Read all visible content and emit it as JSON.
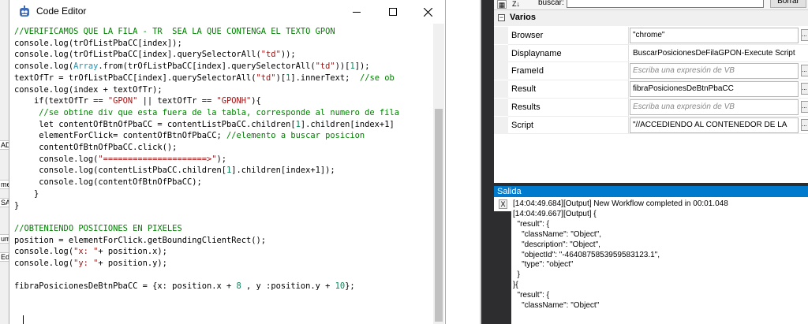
{
  "background_fragments": [
    "ADO",
    "me",
    "SAC",
    "umir",
    "Edit"
  ],
  "editor": {
    "title": "Code Editor",
    "code_lines": [
      [
        {
          "t": "//VERIFICAMOS QUE LA FILA - TR  SEA LA QUE CONTENGA EL TEXTO GPON",
          "k": "comment"
        }
      ],
      [
        {
          "t": "console.log(trOfListPbaCC[index]);",
          "k": "plain"
        }
      ],
      [
        {
          "t": "console.log(trOfListPbaCC[index].querySelectorAll(",
          "k": "plain"
        },
        {
          "t": "\"td\"",
          "k": "string"
        },
        {
          "t": "));",
          "k": "plain"
        }
      ],
      [
        {
          "t": "console.log(",
          "k": "plain"
        },
        {
          "t": "Array",
          "k": "type"
        },
        {
          "t": ".from(trOfListPbaCC[index].querySelectorAll(",
          "k": "plain"
        },
        {
          "t": "\"td\"",
          "k": "string"
        },
        {
          "t": "))[",
          "k": "plain"
        },
        {
          "t": "1",
          "k": "number"
        },
        {
          "t": "]);",
          "k": "plain"
        }
      ],
      [
        {
          "t": "textOfTr = trOfListPbaCC[index].querySelectorAll(",
          "k": "plain"
        },
        {
          "t": "\"td\"",
          "k": "string"
        },
        {
          "t": ")[",
          "k": "plain"
        },
        {
          "t": "1",
          "k": "number"
        },
        {
          "t": "].innerText;  ",
          "k": "plain"
        },
        {
          "t": "//se ob",
          "k": "comment"
        }
      ],
      [
        {
          "t": "console.log(index + textOfTr);",
          "k": "plain"
        }
      ],
      [
        {
          "t": "    if(textOfTr == ",
          "k": "plain"
        },
        {
          "t": "\"GPON\"",
          "k": "string"
        },
        {
          "t": " || textOfTr == ",
          "k": "plain"
        },
        {
          "t": "\"GPONH\"",
          "k": "string"
        },
        {
          "t": "){",
          "k": "plain"
        }
      ],
      [
        {
          "t": "     //se obtine div que esta fuera de la tabla, corresponde al numero de fila",
          "k": "comment"
        }
      ],
      [
        {
          "t": "     let contentOfBtnOfPbaCC = contentListPbaCC.children[",
          "k": "plain"
        },
        {
          "t": "1",
          "k": "number"
        },
        {
          "t": "].children[index+1]",
          "k": "plain"
        }
      ],
      [
        {
          "t": "     elementForClick= contentOfBtnOfPbaCC; ",
          "k": "plain"
        },
        {
          "t": "//elemento a buscar posicion",
          "k": "comment"
        }
      ],
      [
        {
          "t": "     contentOfBtnOfPbaCC.click();",
          "k": "plain"
        }
      ],
      [
        {
          "t": "     console.log(",
          "k": "plain"
        },
        {
          "t": "\"=====================>\"",
          "k": "string"
        },
        {
          "t": ");",
          "k": "plain"
        }
      ],
      [
        {
          "t": "     console.log(contentListPbaCC.children[",
          "k": "plain"
        },
        {
          "t": "1",
          "k": "number"
        },
        {
          "t": "].children[index+1]);",
          "k": "plain"
        }
      ],
      [
        {
          "t": "     console.log(contentOfBtnOfPbaCC);",
          "k": "plain"
        }
      ],
      [
        {
          "t": "    }",
          "k": "plain"
        }
      ],
      [
        {
          "t": "}",
          "k": "plain"
        }
      ],
      [
        {
          "t": "",
          "k": "plain"
        }
      ],
      [
        {
          "t": "//OBTENIENDO POSICIONES EN PIXELES",
          "k": "comment"
        }
      ],
      [
        {
          "t": "position = elementForClick.getBoundingClientRect();",
          "k": "plain"
        }
      ],
      [
        {
          "t": "console.log(",
          "k": "plain"
        },
        {
          "t": "\"x: \"",
          "k": "string"
        },
        {
          "t": "+ position.x);",
          "k": "plain"
        }
      ],
      [
        {
          "t": "console.log(",
          "k": "plain"
        },
        {
          "t": "\"y: \"",
          "k": "string"
        },
        {
          "t": "+ position.y);",
          "k": "plain"
        }
      ],
      [
        {
          "t": "",
          "k": "plain"
        }
      ],
      [
        {
          "t": "fibraPosicionesDeBtnPbaCC = {x: position.x + ",
          "k": "plain"
        },
        {
          "t": "8",
          "k": "number"
        },
        {
          "t": " , y :position.y + ",
          "k": "plain"
        },
        {
          "t": "10",
          "k": "number"
        },
        {
          "t": "};",
          "k": "plain"
        }
      ]
    ]
  },
  "properties": {
    "toolbar_sort_icon": "Z↓",
    "search_label": "buscar:",
    "search_value": "",
    "clear_button": "Borrar",
    "category": "Varios",
    "category_toggle": "−",
    "rows": [
      {
        "name": "Browser",
        "value": "\"chrome\"",
        "placeholder": false
      },
      {
        "name": "Displayname",
        "value": "BuscarPosicionesDeFilaGPON-Execute Script",
        "placeholder": false
      },
      {
        "name": "FrameId",
        "value": "Escriba una expresión de VB",
        "placeholder": true
      },
      {
        "name": "Result",
        "value": "fibraPosicionesDeBtnPbaCC",
        "placeholder": false
      },
      {
        "name": "Results",
        "value": "Escriba una expresión de VB",
        "placeholder": true
      },
      {
        "name": "Script",
        "value": "\"//ACCEDIENDO AL CONTENEDOR DE LA",
        "placeholder": false
      }
    ],
    "ellipsis": "..."
  },
  "output": {
    "title": "Salida",
    "close_label": "X",
    "lines": [
      "[14:04:49.684][Output] New Workflow completed in 00:01.048",
      "[14:04:49.667][Output] {",
      "  \"result\": {",
      "    \"className\": \"Object\",",
      "    \"description\": \"Object\",",
      "    \"objectId\": \"-4640875853959583123.1\",",
      "    \"type\": \"object\"",
      "  }",
      "}{",
      "  \"result\": {",
      "    \"className\": \"Object\""
    ]
  }
}
